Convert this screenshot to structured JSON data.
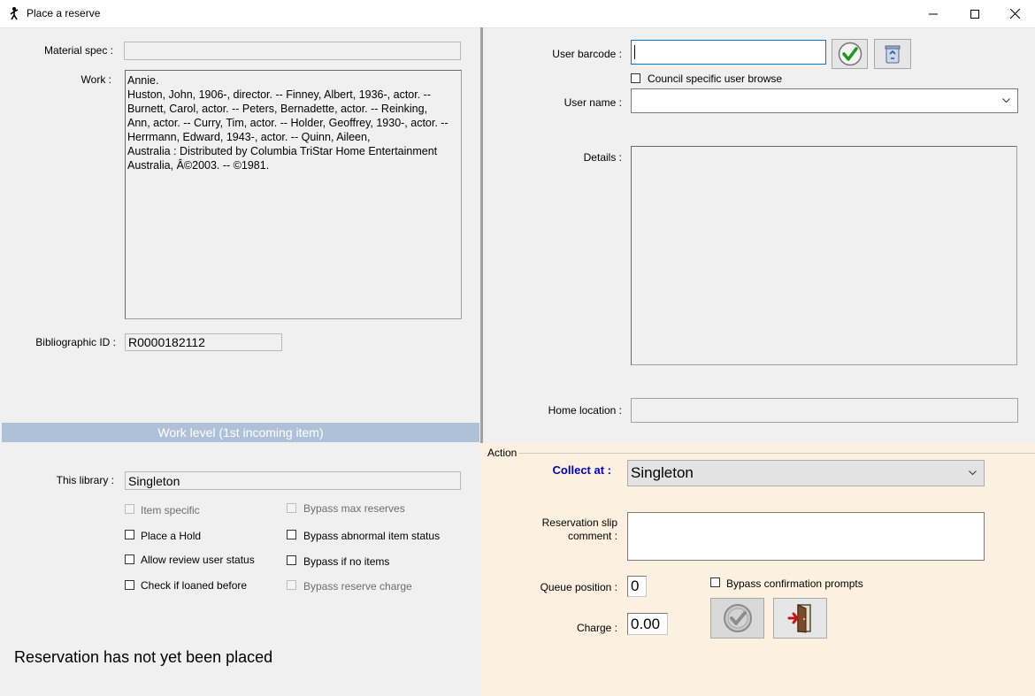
{
  "window": {
    "title": "Place a reserve",
    "icons": {
      "app": "person-reserve-icon",
      "minimize": "minimize-icon",
      "maximize": "maximize-icon",
      "close": "close-icon"
    }
  },
  "left": {
    "material_spec_label": "Material spec :",
    "material_spec_value": "",
    "work_label": "Work :",
    "work_text": "Annie.\nHuston, John, 1906-, director. -- Finney, Albert, 1936-, actor. --\nBurnett, Carol, actor. -- Peters, Bernadette, actor. -- Reinking,\nAnn, actor. -- Curry, Tim, actor. -- Holder, Geoffrey, 1930-, actor. --\nHerrmann, Edward, 1943-, actor. -- Quinn, Aileen,\nAustralia : Distributed by Columbia TriStar Home Entertainment\nAustralia, Â©2003. -- ©1981.",
    "bib_id_label": "Bibliographic ID :",
    "bib_id_value": "R0000182112",
    "section_title": "Work level (1st incoming item)",
    "this_library_label": "This library :",
    "this_library_value": "Singleton",
    "checkboxes": {
      "item_specific": "Item specific",
      "place_hold": "Place a Hold",
      "allow_review": "Allow review user status",
      "check_loaned": "Check if loaned before",
      "bypass_max": "Bypass max reserves",
      "bypass_abnormal": "Bypass abnormal item status",
      "bypass_no_items": "Bypass if no items",
      "bypass_charge": "Bypass reserve charge"
    },
    "status_message": "Reservation has not yet been placed"
  },
  "right": {
    "user_barcode_label": "User barcode :",
    "user_barcode_value": "",
    "council_browse_label": "Council specific user browse",
    "user_name_label": "User name :",
    "user_name_value": "",
    "details_label": "Details :",
    "home_location_label": "Home location :",
    "home_location_value": "",
    "icons": {
      "confirm": "green-check-icon",
      "clear": "recycle-bin-icon"
    }
  },
  "action": {
    "group_title": "Action",
    "collect_at_label": "Collect at :",
    "collect_at_value": "Singleton",
    "slip_comment_label_line1": "Reservation slip",
    "slip_comment_label_line2": "comment :",
    "slip_comment_value": "",
    "queue_position_label": "Queue position :",
    "queue_position_value": "0",
    "charge_label": "Charge :",
    "charge_value": "0.00",
    "bypass_confirm_label": "Bypass confirmation prompts",
    "collect_at_color": "#0000cc",
    "icons": {
      "place": "check-circle-icon",
      "exit": "exit-door-icon"
    }
  }
}
